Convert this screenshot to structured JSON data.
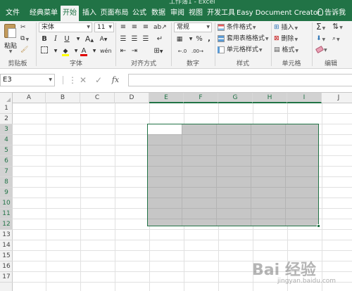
{
  "window": {
    "title": "工作簿1 - Excel"
  },
  "tabs": [
    "文件",
    "经典菜单",
    "开始",
    "插入",
    "页面布局",
    "公式",
    "数据",
    "审阅",
    "视图",
    "开发工具",
    "Easy Document Creator"
  ],
  "active_tab": "开始",
  "tell_me": "告诉我",
  "ribbon": {
    "clipboard": {
      "paste": "粘贴",
      "group": "剪贴板"
    },
    "font": {
      "name": "宋体",
      "size": "11",
      "bold": "B",
      "italic": "I",
      "underline": "U",
      "wen": "wén",
      "group": "字体"
    },
    "alignment": {
      "group": "对齐方式"
    },
    "number": {
      "format": "常规",
      "percent": "%",
      "comma": ",",
      "group": "数字"
    },
    "styles": {
      "conditional": "条件格式",
      "table": "套用表格格式",
      "cell": "单元格样式",
      "group": "样式"
    },
    "cells": {
      "insert": "插入",
      "delete": "删除",
      "format": "格式",
      "group": "单元格"
    },
    "editing": {
      "sum": "Σ",
      "group": "编辑"
    }
  },
  "formula_bar": {
    "name_box": "E3",
    "cancel": "✕",
    "enter": "✓",
    "fx": "fx",
    "value": ""
  },
  "sheet": {
    "columns": [
      "A",
      "B",
      "C",
      "D",
      "E",
      "F",
      "G",
      "H",
      "I",
      "J"
    ],
    "rows": [
      "1",
      "2",
      "3",
      "4",
      "5",
      "6",
      "7",
      "8",
      "9",
      "10",
      "11",
      "12",
      "13",
      "14",
      "15",
      "16",
      "17"
    ],
    "selection": "E3:I12",
    "active_cell": "E3",
    "accent": "#217346",
    "selection_fill": "#c6c6c6"
  },
  "watermark": {
    "logo": "Bai 经验",
    "url": "jingyan.baidu.com"
  }
}
